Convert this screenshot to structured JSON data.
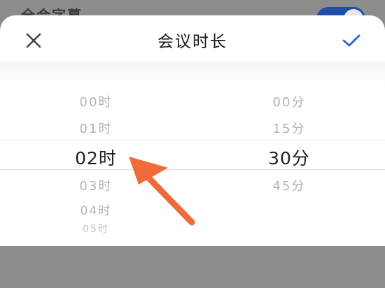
{
  "background": {
    "row_label": "全会字幕",
    "toggle_on": true
  },
  "sheet": {
    "title": "会议时长",
    "close_icon": "close-icon",
    "confirm_icon": "check-icon"
  },
  "picker": {
    "hours": [
      "00时",
      "01时",
      "02时",
      "03时",
      "04时",
      "05时"
    ],
    "minutes": [
      "00分",
      "15分",
      "30分",
      "45分"
    ],
    "selected_hour": "02时",
    "selected_minute": "30分"
  },
  "colors": {
    "accent": "#2a63d0",
    "annotation": "#f06a3a"
  }
}
